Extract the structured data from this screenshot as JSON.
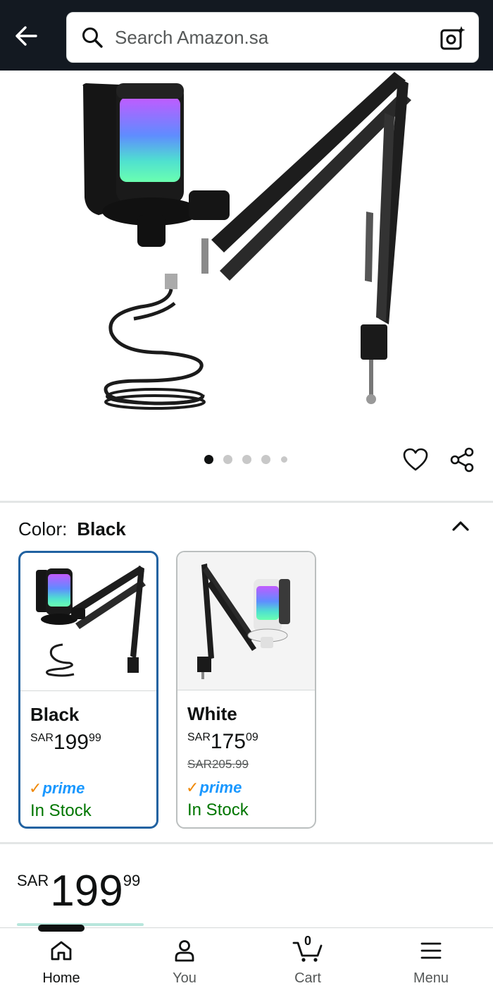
{
  "header": {
    "search_placeholder": "Search Amazon.sa",
    "back_icon": "arrow-left-icon",
    "search_icon": "search-icon",
    "lens_icon": "camera-lens-icon"
  },
  "gallery": {
    "dots_count": 5,
    "active_index": 0,
    "wishlist_icon": "heart-icon",
    "share_icon": "share-icon"
  },
  "color_selector": {
    "label": "Color:",
    "selected": "Black",
    "collapse_icon": "chevron-up-icon",
    "options": [
      {
        "name": "Black",
        "currency": "SAR",
        "whole": "199",
        "fraction": "99",
        "was_price": "",
        "prime": "prime",
        "stock": "In Stock",
        "selected": true
      },
      {
        "name": "White",
        "currency": "SAR",
        "whole": "175",
        "fraction": "09",
        "was_price": "SAR205.99",
        "prime": "prime",
        "stock": "In Stock",
        "selected": false
      }
    ]
  },
  "price": {
    "currency": "SAR",
    "whole": "199",
    "fraction": "99"
  },
  "bottom_nav": [
    {
      "label": "Home",
      "icon": "home-icon",
      "active": true
    },
    {
      "label": "You",
      "icon": "person-icon",
      "active": false
    },
    {
      "label": "Cart",
      "icon": "cart-icon",
      "active": false,
      "count": "0"
    },
    {
      "label": "Menu",
      "icon": "menu-icon",
      "active": false
    }
  ],
  "colors": {
    "header_bg": "#131921",
    "selected_border": "#2162a1",
    "in_stock": "#007600",
    "prime_blue": "#1a98ff",
    "prime_check": "#f08804"
  }
}
